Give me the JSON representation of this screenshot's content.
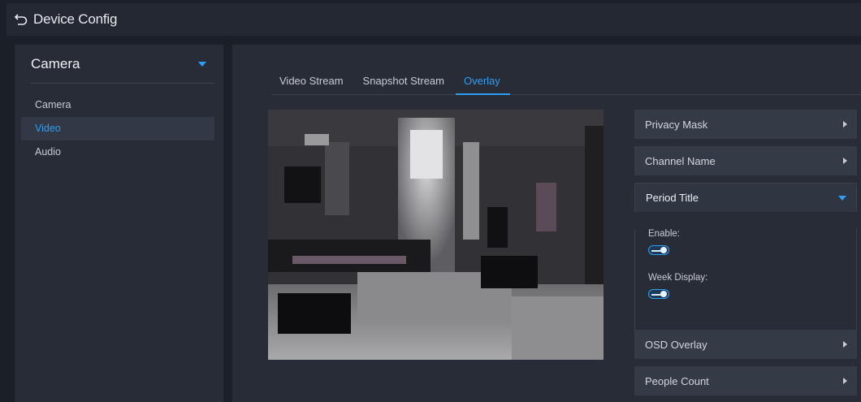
{
  "header": {
    "title": "Device Config",
    "back_icon": "back-arrow-icon"
  },
  "sidebar": {
    "section": "Camera",
    "items": [
      {
        "label": "Camera",
        "active": false
      },
      {
        "label": "Video",
        "active": true
      },
      {
        "label": "Audio",
        "active": false
      }
    ]
  },
  "tabs": [
    {
      "label": "Video Stream",
      "active": false
    },
    {
      "label": "Snapshot Stream",
      "active": false
    },
    {
      "label": "Overlay",
      "active": true
    }
  ],
  "overlay_panels": {
    "privacy_mask": "Privacy Mask",
    "channel_name": "Channel Name",
    "period_title": "Period Title",
    "enable_label": "Enable:",
    "enable_value": true,
    "week_display_label": "Week Display:",
    "week_display_value": true,
    "osd_overlay": "OSD Overlay",
    "people_count": "People Count"
  },
  "colors": {
    "accent": "#2e9ef3",
    "background": "#1b1f27",
    "panel": "#272c36"
  }
}
